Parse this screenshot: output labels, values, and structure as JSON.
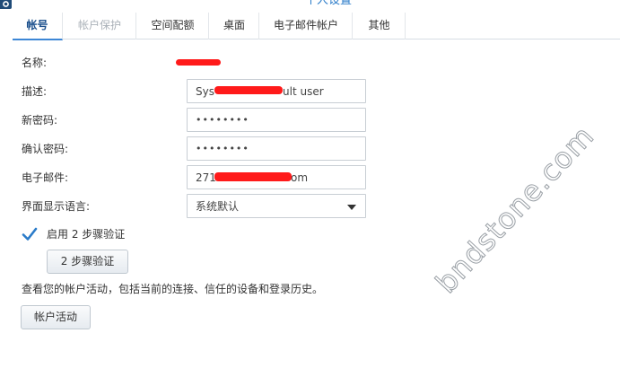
{
  "window": {
    "title": "个人设置"
  },
  "tabs": [
    {
      "label": "帐号",
      "state": "active"
    },
    {
      "label": "帐户保护",
      "state": "disabled"
    },
    {
      "label": "空间配额",
      "state": "normal"
    },
    {
      "label": "桌面",
      "state": "normal"
    },
    {
      "label": "电子邮件帐户",
      "state": "normal"
    },
    {
      "label": "其他",
      "state": "normal"
    }
  ],
  "form": {
    "name": {
      "label": "名称:",
      "value": ""
    },
    "description": {
      "label": "描述:",
      "value": "System default user",
      "value_visible_prefix": "Sys",
      "value_visible_suffix": "ult user"
    },
    "new_password": {
      "label": "新密码:",
      "value": "••••••••"
    },
    "confirm_password": {
      "label": "确认密码:",
      "value": "••••••••"
    },
    "email": {
      "label": "电子邮件:",
      "value_visible_prefix": "271",
      "value_visible_suffix": "om"
    },
    "language": {
      "label": "界面显示语言:",
      "selected": "系统默认"
    }
  },
  "two_step": {
    "checkbox_label": "启用 2 步骤验证",
    "checked": true,
    "button_label": "2 步骤验证"
  },
  "activity": {
    "note": "查看您的帐户活动，包括当前的连接、信任的设备和登录历史。",
    "button_label": "帐户活动"
  },
  "watermark": "bndstone.com",
  "colors": {
    "accent": "#3d87d6",
    "redaction": "#ff1a1a",
    "check": "#2a7bc9"
  }
}
